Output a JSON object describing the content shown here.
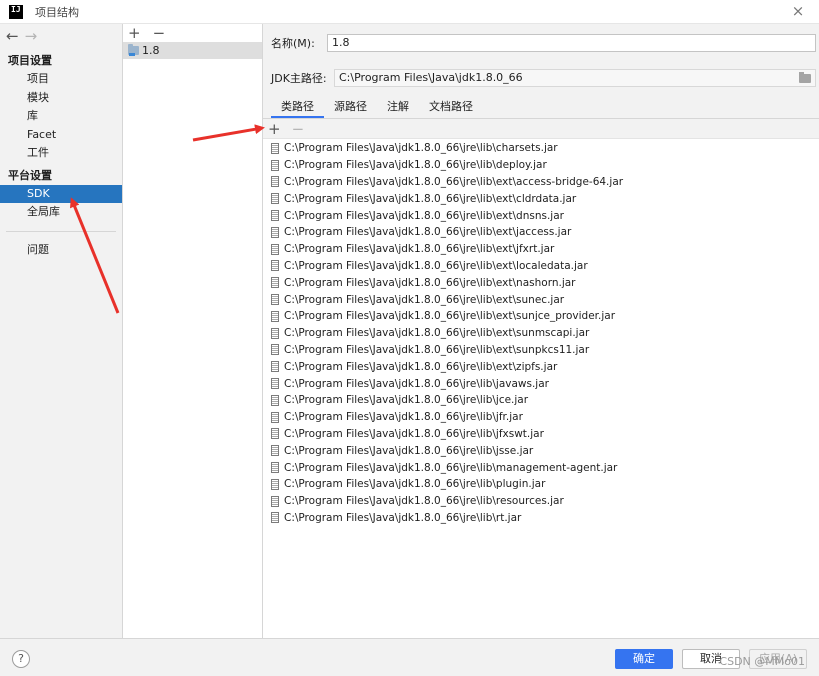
{
  "window": {
    "title": "项目结构",
    "logo_text": "IJ",
    "close_glyph": "×"
  },
  "nav": {
    "back_glyph": "←",
    "forward_glyph": "→",
    "sections": [
      {
        "label": "项目设置",
        "items": [
          "项目",
          "模块",
          "库",
          "Facet",
          "工件"
        ]
      },
      {
        "label": "平台设置",
        "items": [
          "SDK",
          "全局库"
        ]
      }
    ],
    "extra_items": [
      "问题"
    ],
    "selected": "SDK"
  },
  "sdk_list": {
    "add_glyph": "+",
    "remove_glyph": "−",
    "items": [
      {
        "name": "1.8",
        "icon": "jdk-folder-icon"
      }
    ]
  },
  "detail": {
    "name_label": "名称(M):",
    "name_value": "1.8",
    "home_label": "JDK主路径:",
    "home_value": "C:\\Program Files\\Java\\jdk1.8.0_66",
    "tabs": [
      "类路径",
      "源路径",
      "注解",
      "文档路径"
    ],
    "active_tab": "类路径",
    "add_glyph": "+",
    "remove_glyph": "−",
    "classpath": [
      "C:\\Program Files\\Java\\jdk1.8.0_66\\jre\\lib\\charsets.jar",
      "C:\\Program Files\\Java\\jdk1.8.0_66\\jre\\lib\\deploy.jar",
      "C:\\Program Files\\Java\\jdk1.8.0_66\\jre\\lib\\ext\\access-bridge-64.jar",
      "C:\\Program Files\\Java\\jdk1.8.0_66\\jre\\lib\\ext\\cldrdata.jar",
      "C:\\Program Files\\Java\\jdk1.8.0_66\\jre\\lib\\ext\\dnsns.jar",
      "C:\\Program Files\\Java\\jdk1.8.0_66\\jre\\lib\\ext\\jaccess.jar",
      "C:\\Program Files\\Java\\jdk1.8.0_66\\jre\\lib\\ext\\jfxrt.jar",
      "C:\\Program Files\\Java\\jdk1.8.0_66\\jre\\lib\\ext\\localedata.jar",
      "C:\\Program Files\\Java\\jdk1.8.0_66\\jre\\lib\\ext\\nashorn.jar",
      "C:\\Program Files\\Java\\jdk1.8.0_66\\jre\\lib\\ext\\sunec.jar",
      "C:\\Program Files\\Java\\jdk1.8.0_66\\jre\\lib\\ext\\sunjce_provider.jar",
      "C:\\Program Files\\Java\\jdk1.8.0_66\\jre\\lib\\ext\\sunmscapi.jar",
      "C:\\Program Files\\Java\\jdk1.8.0_66\\jre\\lib\\ext\\sunpkcs11.jar",
      "C:\\Program Files\\Java\\jdk1.8.0_66\\jre\\lib\\ext\\zipfs.jar",
      "C:\\Program Files\\Java\\jdk1.8.0_66\\jre\\lib\\javaws.jar",
      "C:\\Program Files\\Java\\jdk1.8.0_66\\jre\\lib\\jce.jar",
      "C:\\Program Files\\Java\\jdk1.8.0_66\\jre\\lib\\jfr.jar",
      "C:\\Program Files\\Java\\jdk1.8.0_66\\jre\\lib\\jfxswt.jar",
      "C:\\Program Files\\Java\\jdk1.8.0_66\\jre\\lib\\jsse.jar",
      "C:\\Program Files\\Java\\jdk1.8.0_66\\jre\\lib\\management-agent.jar",
      "C:\\Program Files\\Java\\jdk1.8.0_66\\jre\\lib\\plugin.jar",
      "C:\\Program Files\\Java\\jdk1.8.0_66\\jre\\lib\\resources.jar",
      "C:\\Program Files\\Java\\jdk1.8.0_66\\jre\\lib\\rt.jar"
    ]
  },
  "footer": {
    "help_glyph": "?",
    "ok_label": "确定",
    "cancel_label": "取消",
    "apply_label": "应用(A)",
    "watermark": "CSDN @MMo01"
  },
  "colors": {
    "selection": "#2675bf",
    "primary_button": "#3574f0",
    "annotation_arrow": "#e8312a"
  }
}
